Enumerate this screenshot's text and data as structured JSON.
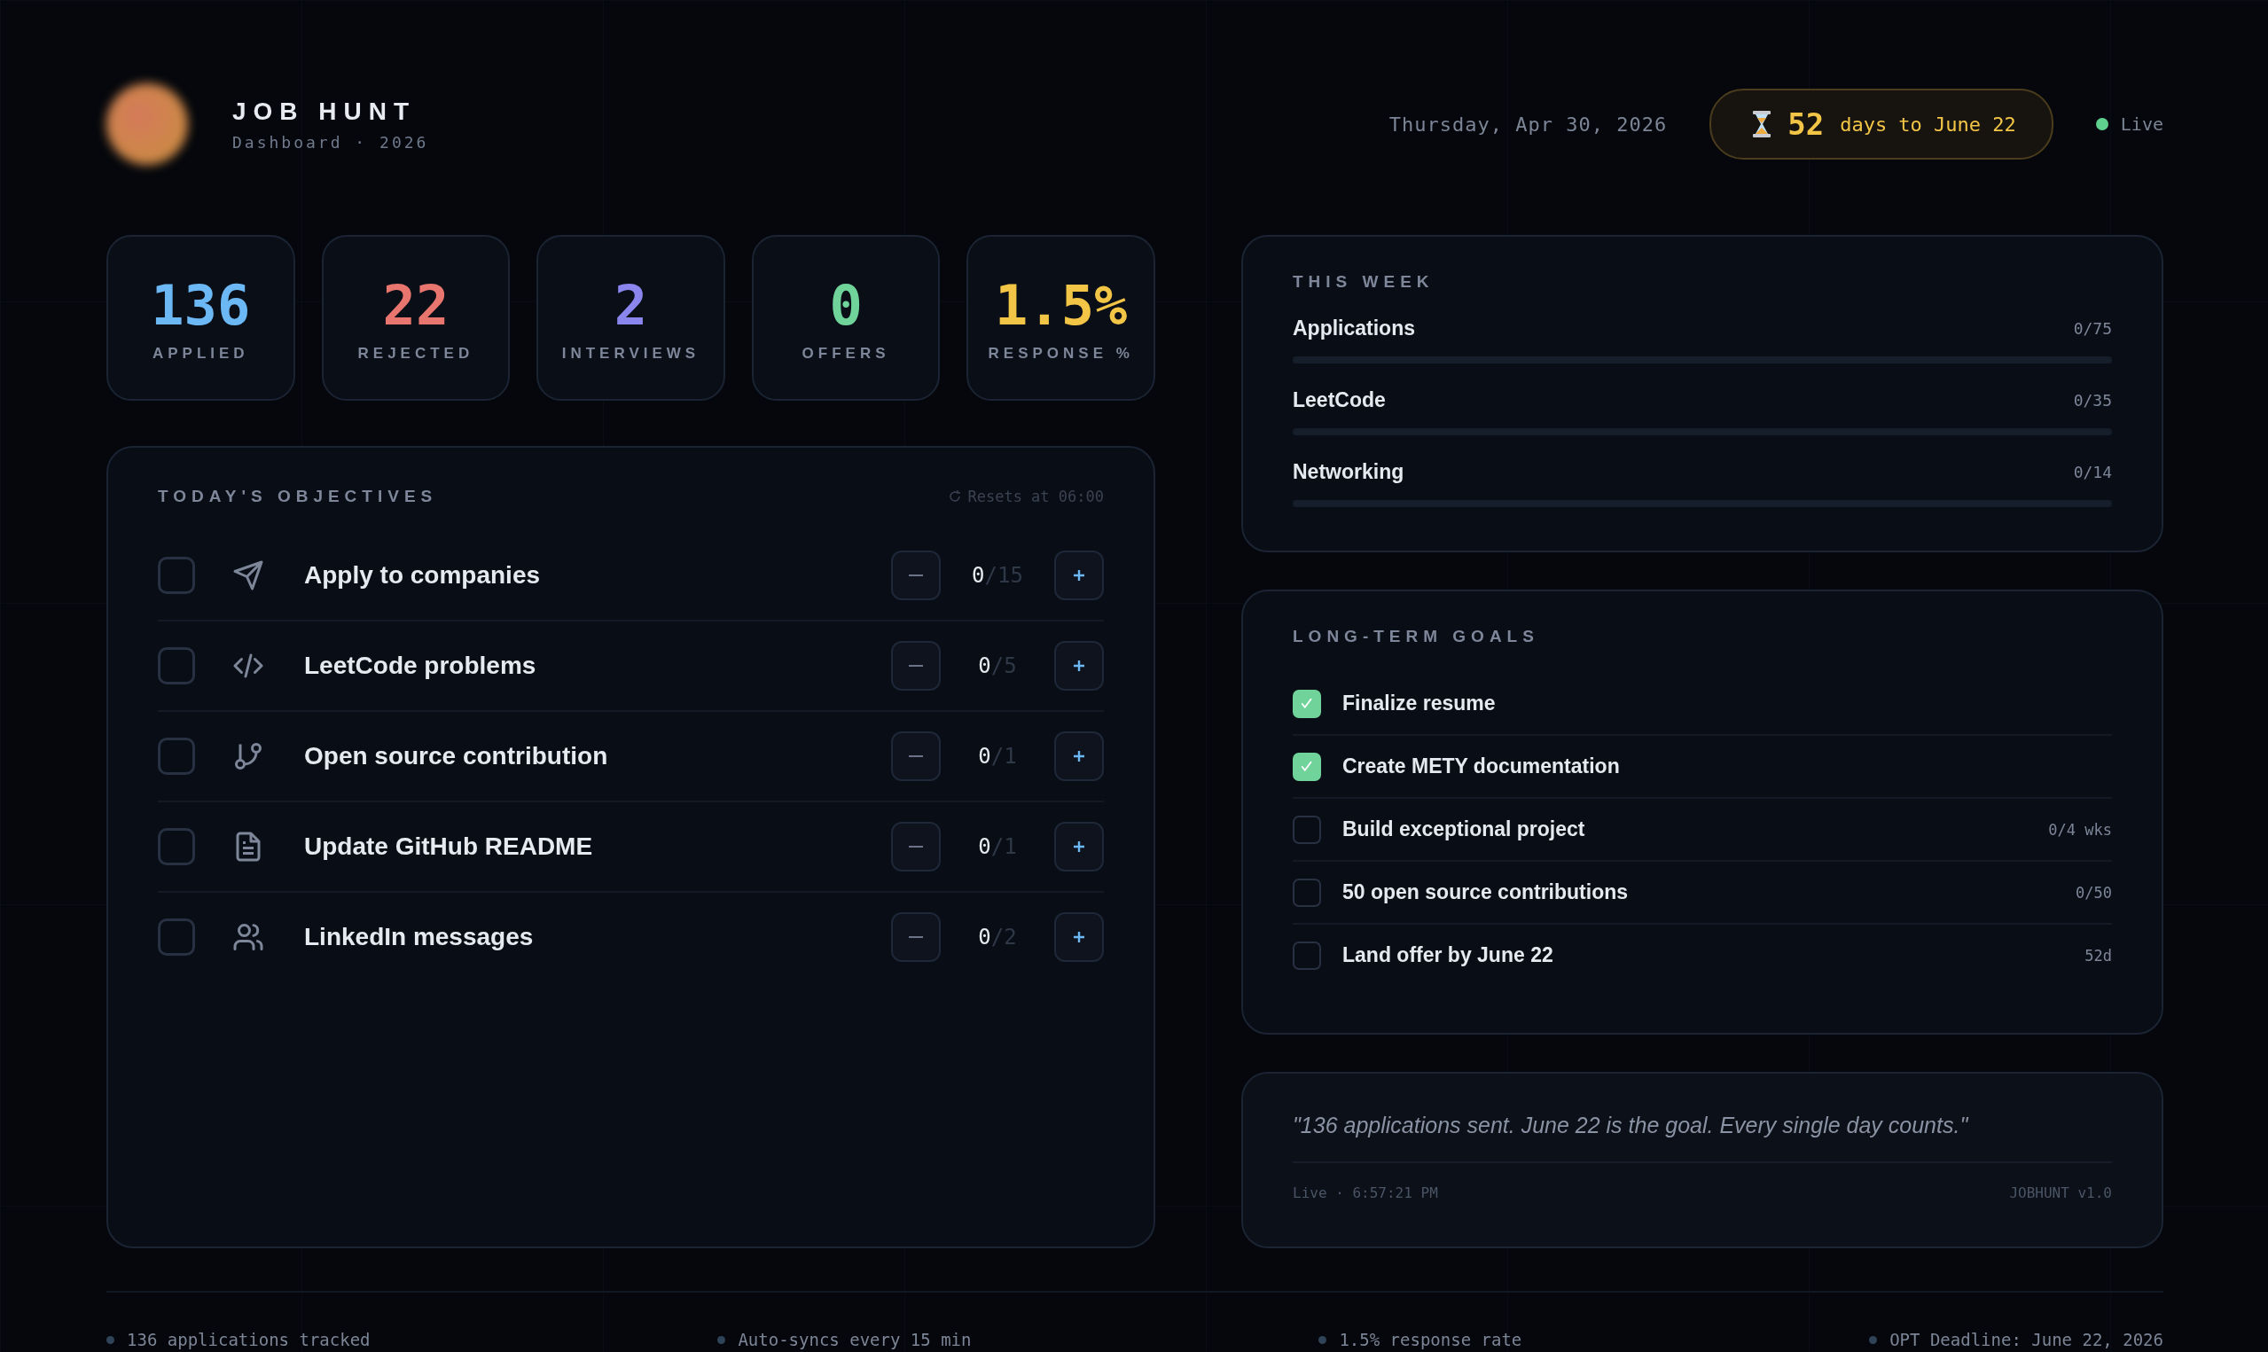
{
  "brand": {
    "title": "JOB HUNT",
    "subtitle": "Dashboard · 2026"
  },
  "header": {
    "date": "Thursday, Apr 30, 2026",
    "countdown": {
      "number": "52",
      "text": "days to June 22"
    },
    "live": "Live"
  },
  "stats": [
    {
      "value": "136",
      "label": "APPLIED",
      "color": "#6cb8f5"
    },
    {
      "value": "22",
      "label": "REJECTED",
      "color": "#e8766f"
    },
    {
      "value": "2",
      "label": "INTERVIEWS",
      "color": "#8b86ee"
    },
    {
      "value": "0",
      "label": "OFFERS",
      "color": "#6fd39a"
    },
    {
      "value": "1.5%",
      "label": "RESPONSE %",
      "color": "#f3c546"
    }
  ],
  "objectives": {
    "title": "TODAY'S OBJECTIVES",
    "reset_note": "Resets at 06:00",
    "items": [
      {
        "label": "Apply to companies",
        "kind": "send",
        "checked": false,
        "count": "0",
        "target": "/15"
      },
      {
        "label": "LeetCode problems",
        "kind": "code",
        "checked": false,
        "count": "0",
        "target": "/5"
      },
      {
        "label": "Open source contribution",
        "kind": "branch",
        "checked": false,
        "count": "0",
        "target": "/1"
      },
      {
        "label": "Update GitHub README",
        "kind": "file",
        "checked": false,
        "count": "0",
        "target": "/1"
      },
      {
        "label": "LinkedIn messages",
        "kind": "users",
        "checked": false,
        "count": "0",
        "target": "/2"
      }
    ]
  },
  "this_week": {
    "title": "THIS WEEK",
    "items": [
      {
        "label": "Applications",
        "reading": "0/75",
        "level": 0
      },
      {
        "label": "LeetCode",
        "reading": "0/35",
        "level": 0
      },
      {
        "label": "Networking",
        "reading": "0/14",
        "level": 0
      }
    ]
  },
  "goals": {
    "title": "LONG-TERM GOALS",
    "items": [
      {
        "label": "Finalize resume",
        "checked": true
      },
      {
        "label": "Create METY documentation",
        "checked": true
      },
      {
        "label": "Build exceptional project",
        "checked": false,
        "reading": "0/4 wks"
      },
      {
        "label": "50 open source contributions",
        "checked": false,
        "reading": "0/50"
      },
      {
        "label": "Land offer by June 22",
        "checked": false,
        "reading": "52d"
      }
    ]
  },
  "quote": {
    "text": "\"136 applications sent. June 22 is the goal. Every single day counts.\"",
    "status": "Live · 6:57:21 PM",
    "version": "JOBHUNT v1.0"
  },
  "footer": [
    "136 applications tracked",
    "Auto-syncs every 15 min",
    "1.5% response rate",
    "OPT Deadline: June 22, 2026"
  ]
}
